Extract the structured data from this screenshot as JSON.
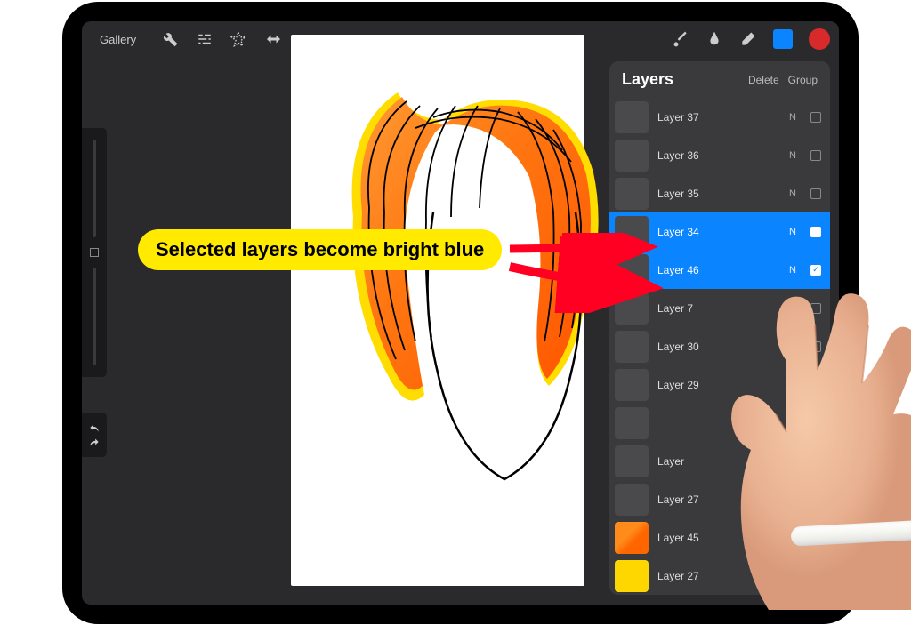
{
  "toolbar": {
    "gallery_label": "Gallery"
  },
  "layers_panel": {
    "title": "Layers",
    "delete_label": "Delete",
    "group_label": "Group",
    "blend_label": "N",
    "items": [
      {
        "name": "Layer 37",
        "selected": false,
        "checked": false,
        "thumb": "sketch"
      },
      {
        "name": "Layer 36",
        "selected": false,
        "checked": false,
        "thumb": "sketch"
      },
      {
        "name": "Layer 35",
        "selected": false,
        "checked": false,
        "thumb": "sketch"
      },
      {
        "name": "Layer 34",
        "selected": true,
        "checked": false,
        "thumb": "sketch"
      },
      {
        "name": "Layer 46",
        "selected": true,
        "checked": true,
        "thumb": "sketch"
      },
      {
        "name": "Layer 7",
        "selected": false,
        "checked": false,
        "thumb": "sketch"
      },
      {
        "name": "Layer 30",
        "selected": false,
        "checked": false,
        "thumb": "sketch"
      },
      {
        "name": "Layer 29",
        "selected": false,
        "checked": false,
        "thumb": "sketch"
      },
      {
        "name": "",
        "selected": false,
        "checked": false,
        "thumb": "sketch"
      },
      {
        "name": "Layer",
        "selected": false,
        "checked": false,
        "thumb": "sketch"
      },
      {
        "name": "Layer 27",
        "selected": false,
        "checked": false,
        "thumb": "sketch"
      },
      {
        "name": "Layer 45",
        "selected": false,
        "checked": false,
        "thumb": "orange-hair"
      },
      {
        "name": "Layer 27",
        "selected": false,
        "checked": false,
        "thumb": "yellow-hair"
      }
    ]
  },
  "annotation": {
    "text": "Selected layers become bright blue"
  },
  "colors": {
    "accent": "#0a84ff",
    "highlight": "#ffea00",
    "brush_color": "#d82a2a"
  }
}
